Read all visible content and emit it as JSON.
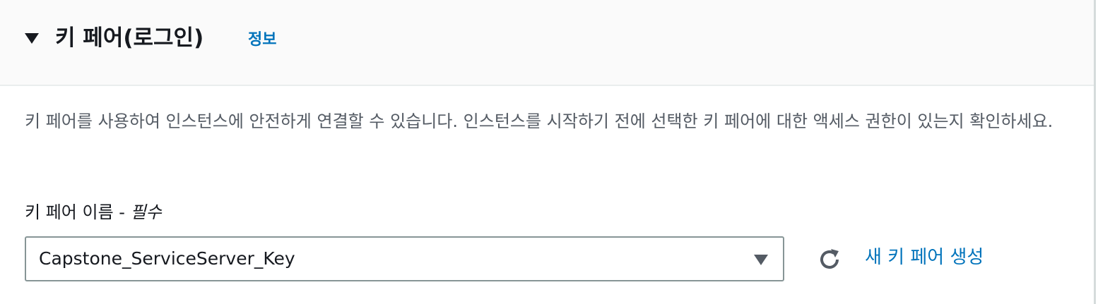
{
  "section": {
    "title": "키 페어(로그인)",
    "info_link": "정보",
    "description": "키 페어를 사용하여 인스턴스에 안전하게 연결할 수 있습니다. 인스턴스를 시작하기 전에 선택한 키 페어에 대한 액세스 권한이 있는지 확인하세요."
  },
  "key_pair_field": {
    "label": "키 페어 이름 - ",
    "required": "필수",
    "selected_value": "Capstone_ServiceServer_Key"
  },
  "actions": {
    "refresh_icon": "refresh-icon",
    "create_new_label": "새 키 페어 생성"
  },
  "colors": {
    "link": "#0073bb",
    "header_bg": "#fafafa",
    "text": "#16191f",
    "secondary_text": "#545b64",
    "border": "#879596"
  }
}
